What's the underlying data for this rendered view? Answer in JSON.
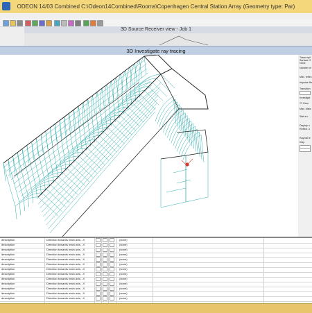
{
  "app": {
    "title": "ODEON 14/03 Combined   C:\\Odeon14Combined\\Rooms\\Copenhagen Central Station Array   (Geometry type: Par)"
  },
  "back_window": {
    "title": "3D Source Receiver view - Job 1"
  },
  "dialog": {
    "title": "3D Investigate ray tracing"
  },
  "side_panel": {
    "labels": [
      "Trace repl",
      "Surface O",
      "None",
      "Number of",
      "Max. reflec",
      "Impulse Re",
      "Transition",
      "Investigat",
      "71 Grou",
      "Max. dista",
      "Stat at r",
      "Display o",
      "Reflect. o",
      "Ray tail le",
      "Disp"
    ]
  },
  "table": {
    "rows": [
      {
        "c1": "description",
        "c2": "Direction towards main axis, -X",
        "c3": "(none)"
      },
      {
        "c1": "description",
        "c2": "Direction towards main axis, -X",
        "c3": "(none)"
      },
      {
        "c1": "description",
        "c2": "Direction towards main axis, -X",
        "c3": "(none)"
      },
      {
        "c1": "description",
        "c2": "Direction towards main axis, -X",
        "c3": "(none)"
      },
      {
        "c1": "description",
        "c2": "Direction towards main axis, -X",
        "c3": "(none)"
      },
      {
        "c1": "description",
        "c2": "Direction towards main axis, -X",
        "c3": "(none)"
      },
      {
        "c1": "description",
        "c2": "Direction towards main axis, -X",
        "c3": "(none)"
      },
      {
        "c1": "description",
        "c2": "Direction towards main axis, -X",
        "c3": "(none)"
      },
      {
        "c1": "description",
        "c2": "Direction towards main axis, -X",
        "c3": "(none)"
      },
      {
        "c1": "description",
        "c2": "Direction towards main axis, -X",
        "c3": "(none)"
      },
      {
        "c1": "description",
        "c2": "Direction towards main axis, -X",
        "c3": "(none)"
      },
      {
        "c1": "description",
        "c2": "Direction towards main axis, -X",
        "c3": "(none)"
      },
      {
        "c1": "description",
        "c2": "Direction towards main axis, -X",
        "c3": "(none)"
      }
    ]
  },
  "colors": {
    "wireframe": "#16a3a3",
    "edge": "#222222",
    "source": "#d63a2f",
    "titlebar": "#f4d77b"
  }
}
